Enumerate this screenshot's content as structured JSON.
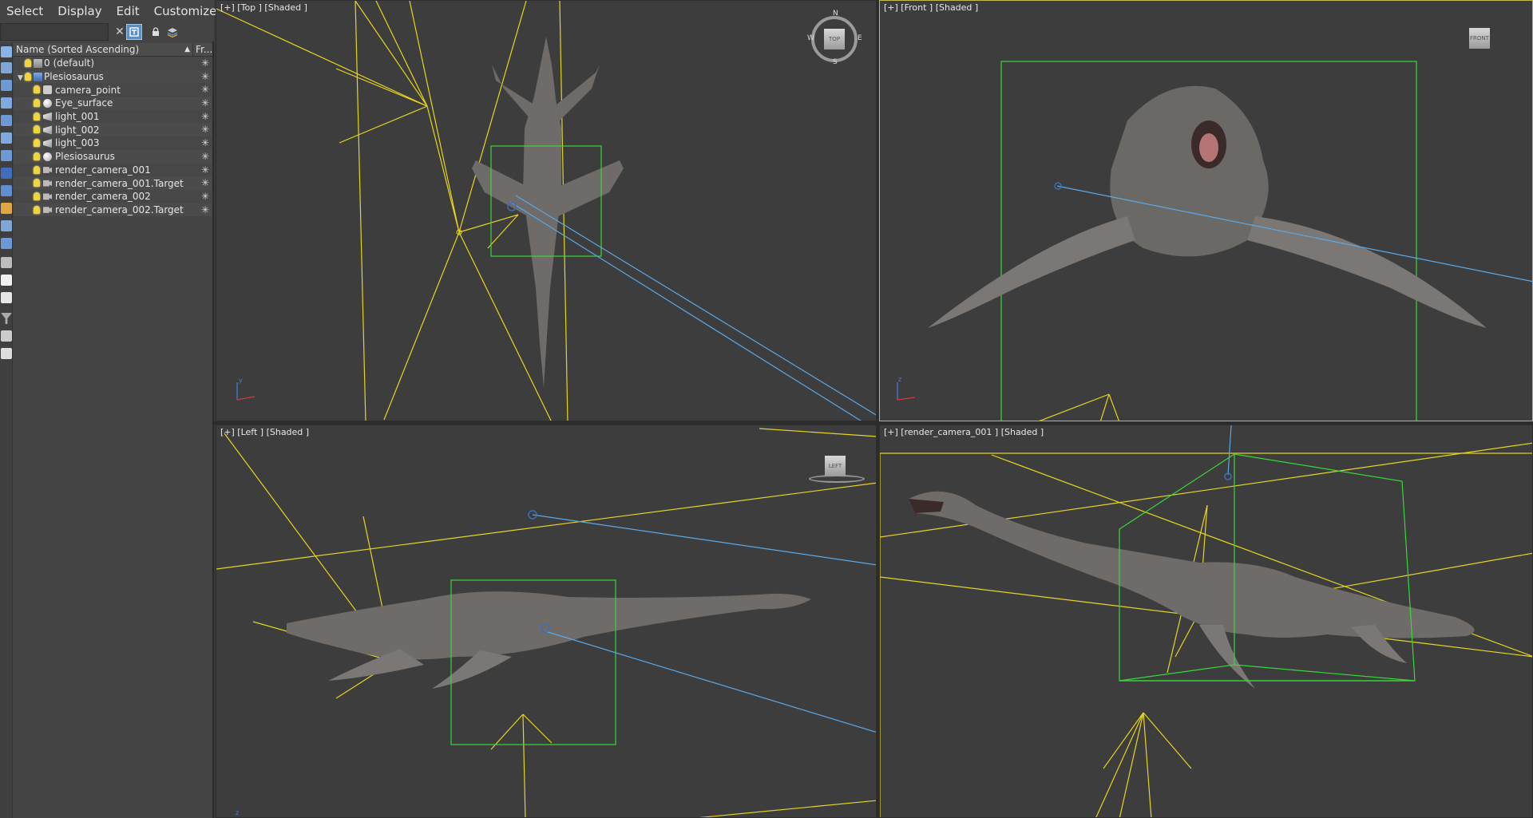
{
  "explorer": {
    "menu": [
      "Select",
      "Display",
      "Edit",
      "Customize"
    ],
    "search": {
      "value": "",
      "placeholder": ""
    },
    "columns": {
      "name": "Name (Sorted Ascending)",
      "frozen": "Fr..."
    },
    "rows": [
      {
        "label": "0 (default)",
        "icon": "layer-icon",
        "depth": 1,
        "frozen": "✳"
      },
      {
        "label": "Plesiosaurus",
        "icon": "layer-icon",
        "depth": 1,
        "frozen": "✳",
        "expanded": true
      },
      {
        "label": "camera_point",
        "icon": "point-helper-icon",
        "depth": 2,
        "frozen": "✳"
      },
      {
        "label": "Eye_surface",
        "icon": "sphere-icon",
        "depth": 2,
        "frozen": "✳"
      },
      {
        "label": "light_001",
        "icon": "light-icon",
        "depth": 2,
        "frozen": "✳"
      },
      {
        "label": "light_002",
        "icon": "light-icon",
        "depth": 2,
        "frozen": "✳"
      },
      {
        "label": "light_003",
        "icon": "light-icon",
        "depth": 2,
        "frozen": "✳"
      },
      {
        "label": "Plesiosaurus",
        "icon": "sphere-icon",
        "depth": 2,
        "frozen": "✳"
      },
      {
        "label": "render_camera_001",
        "icon": "camera-icon",
        "depth": 2,
        "frozen": "✳"
      },
      {
        "label": "render_camera_001.Target",
        "icon": "camera-icon",
        "depth": 2,
        "frozen": "✳"
      },
      {
        "label": "render_camera_002",
        "icon": "camera-icon",
        "depth": 2,
        "frozen": "✳"
      },
      {
        "label": "render_camera_002.Target",
        "icon": "camera-icon",
        "depth": 2,
        "frozen": "✳"
      }
    ]
  },
  "viewports": {
    "top": {
      "label": "[+] [Top ] [Shaded ]",
      "cube": "TOP",
      "compass": {
        "n": "N",
        "s": "S",
        "e": "E",
        "w": "W"
      }
    },
    "front": {
      "label": "[+] [Front ] [Shaded ]",
      "cube": "FRONT"
    },
    "left": {
      "label": "[+] [Left ] [Shaded ]",
      "cube": "LEFT"
    },
    "camera": {
      "label": "[+] [render_camera_001 ] [Shaded ]"
    }
  },
  "axis": {
    "x": "x",
    "y": "y",
    "z": "z"
  },
  "colors": {
    "light_lines": "#e6d61e",
    "camera_lines": "#5aa9e8",
    "bounding_box": "#38d838",
    "creature": "#6b6966",
    "active_viewport_border": "#c7b84a"
  }
}
